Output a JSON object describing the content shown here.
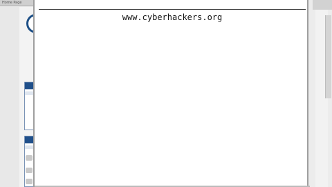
{
  "background_window": {
    "tab_title": "Home Page"
  },
  "popup": {
    "url_text": "www.cyberhackers.org"
  }
}
